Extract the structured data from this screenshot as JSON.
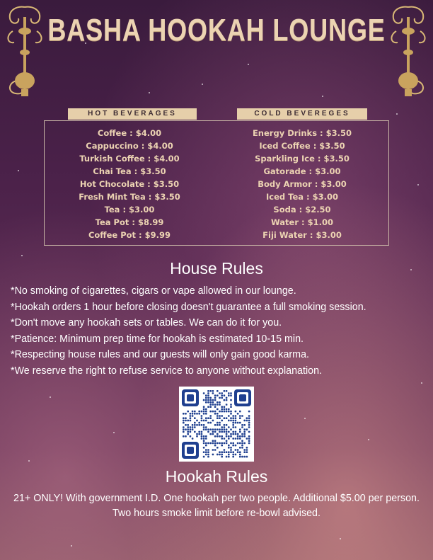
{
  "header": {
    "title": "BASHA HOOKAH LOUNGE"
  },
  "menu": {
    "hot": {
      "heading": "HOT BEVERAGES",
      "items": [
        "Coffee : $4.00",
        "Cappuccino : $4.00",
        "Turkish Coffee : $4.00",
        "Chai Tea : $3.50",
        "Hot Chocolate : $3.50",
        "Fresh Mint Tea : $3.50",
        "Tea : $3.00",
        "Tea Pot : $8.99",
        "Coffee Pot : $9.99"
      ]
    },
    "cold": {
      "heading": "COLD BEVEREGES",
      "items": [
        "Energy Drinks : $3.50",
        "Iced Coffee : $3.50",
        "Sparkling Ice : $3.50",
        "Gatorade : $3.00",
        "Body Armor : $3.00",
        "Iced Tea : $3.00",
        "Soda : $2.50",
        "Water : $1.00",
        "Fiji Water : $3.00"
      ]
    }
  },
  "house_rules": {
    "title": "House Rules",
    "items": [
      "*No smoking of cigarettes, cigars or vape allowed in our lounge.",
      "*Hookah orders 1 hour before closing doesn't guarantee a full smoking session.",
      "*Don't move any hookah sets or tables. We can do it for you.",
      "*Patience: Minimum prep time for hookah is estimated 10-15 min.",
      "*Respecting house rules and our guests will only gain good karma.",
      "*We reserve the right to refuse service to anyone without explanation."
    ]
  },
  "qr": {
    "icon": "qr-code-icon"
  },
  "hookah_rules": {
    "title": "Hookah Rules",
    "text": "21+ ONLY! With government I.D. One hookah per two people. Additional $5.00 per person. Two hours smoke limit before re-bowl advised."
  },
  "colors": {
    "gold": "#ecd3b2",
    "header_band": "#e6cfaa",
    "qr_blue": "#1f3f8f"
  }
}
